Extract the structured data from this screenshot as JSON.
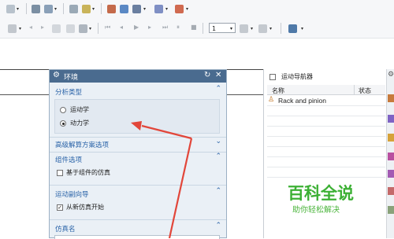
{
  "toolbar2": {
    "frame_value": "1"
  },
  "dialog": {
    "title": "环境",
    "section_analysis": {
      "title": "分析类型",
      "options": [
        "运动学",
        "动力学"
      ],
      "selected": "动力学"
    },
    "section_solver": {
      "title": "高级解算方案选项"
    },
    "section_component": {
      "title": "组件选项",
      "checkbox_label": "基于组件的仿真",
      "checked": false
    },
    "section_wizard": {
      "title": "运动副向导",
      "checkbox_label": "从新仿真开始",
      "checked": true
    },
    "section_name": {
      "title": "仿真名"
    }
  },
  "navigator": {
    "title": "运动导航器",
    "col_name": "名称",
    "col_status": "状态",
    "row_name": "Rack and pinion"
  },
  "watermark": {
    "title": "百科全说",
    "subtitle": "助你轻松解决"
  },
  "colors": {
    "dialog_header": "#4a6b8f",
    "section_text": "#2a63a8",
    "arrow": "#e2463a",
    "watermark": "#3cb034"
  }
}
